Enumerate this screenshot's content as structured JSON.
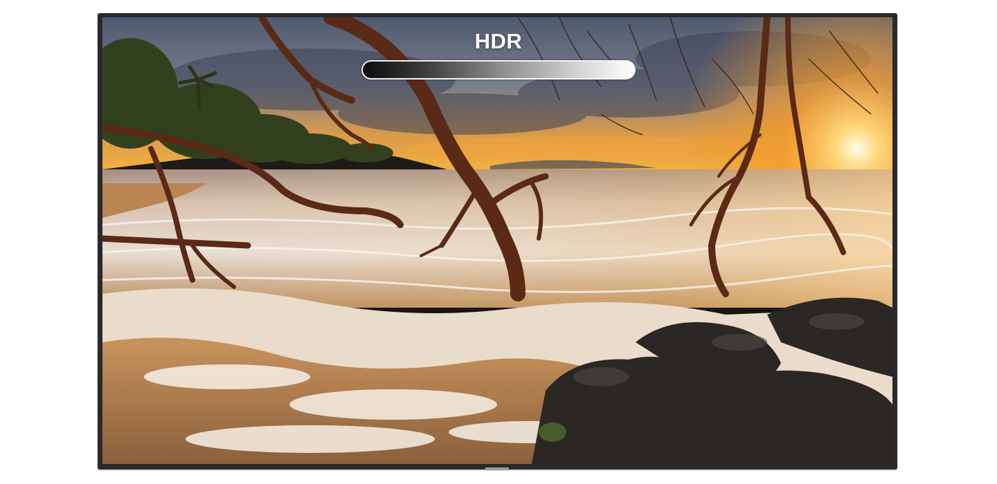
{
  "overlay": {
    "label": "HDR",
    "gradient_bar": {
      "from_color": "#0c0c0c",
      "to_color": "#ffffff",
      "border_color": "#f4f4f4"
    }
  },
  "scene": {
    "colors": {
      "sky_top": "#5a6478",
      "sunset_glow": "#f6a32a",
      "sun": "#fff6d8",
      "sea": "#c9a27a",
      "foam": "#f1ece4",
      "branches": "#5a2a16",
      "rocks": "#2b2724",
      "foliage": "#3d4a22"
    }
  },
  "device": {
    "frame_color": "#2a2a2c"
  }
}
